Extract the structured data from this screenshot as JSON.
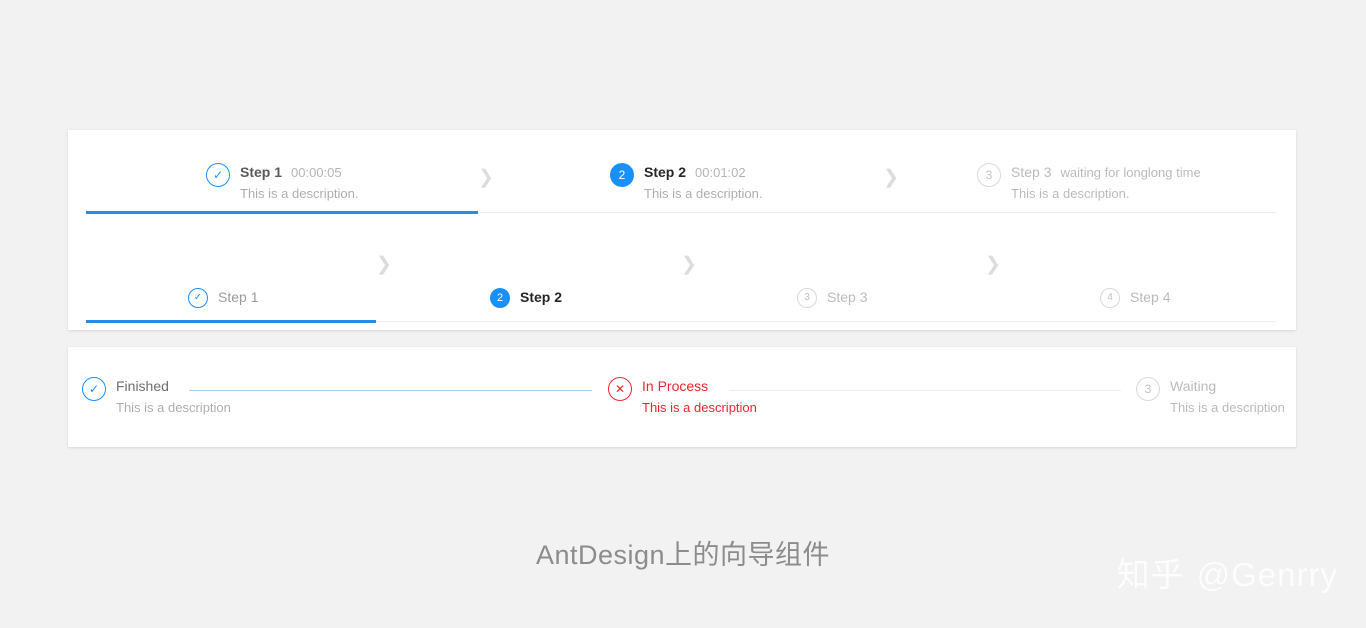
{
  "page": {
    "background_color": "#f2f2f2",
    "caption": "AntDesign上的向导组件",
    "watermark_logo": "知乎",
    "watermark_user": "@Genrry"
  },
  "colors": {
    "primary": "#1890ff",
    "progress_bar": "#2a8bdf",
    "error": "#f5222d",
    "wait_text": "rgba(0,0,0,0.28)",
    "track": "#efefef",
    "connector_finish": "#a6cdea",
    "connector_wait": "#ececec"
  },
  "icons": {
    "check": "✓",
    "close": "✕",
    "chevron_right": "❯"
  },
  "steps_with_description": {
    "name": "steps-with-subtitle-and-description",
    "progress_percent": 33,
    "steps": [
      {
        "title": "Step 1",
        "subtitle": "00:00:05",
        "description": "This is a description.",
        "status": "finish",
        "icon": "check"
      },
      {
        "title": "Step 2",
        "subtitle": "00:01:02",
        "description": "This is a description.",
        "status": "process",
        "icon": "2"
      },
      {
        "title": "Step 3",
        "subtitle": "waiting for longlong time",
        "description": "This is a description.",
        "status": "wait",
        "icon": "3"
      }
    ]
  },
  "steps_navigation": {
    "name": "steps-navigation-compact",
    "progress_percent": 25,
    "steps": [
      {
        "title": "Step 1",
        "status": "finish",
        "icon": "check"
      },
      {
        "title": "Step 2",
        "status": "process",
        "icon": "2"
      },
      {
        "title": "Step 3",
        "status": "wait",
        "icon": "3"
      },
      {
        "title": "Step 4",
        "status": "wait",
        "icon": "4"
      }
    ]
  },
  "steps_status": {
    "name": "steps-with-error-status",
    "steps": [
      {
        "title": "Finished",
        "description": "This is a description",
        "status": "finish",
        "icon": "check"
      },
      {
        "title": "In Process",
        "description": "This is a description",
        "status": "error",
        "icon": "close"
      },
      {
        "title": "Waiting",
        "description": "This is a description",
        "status": "wait",
        "icon": "3"
      }
    ]
  }
}
